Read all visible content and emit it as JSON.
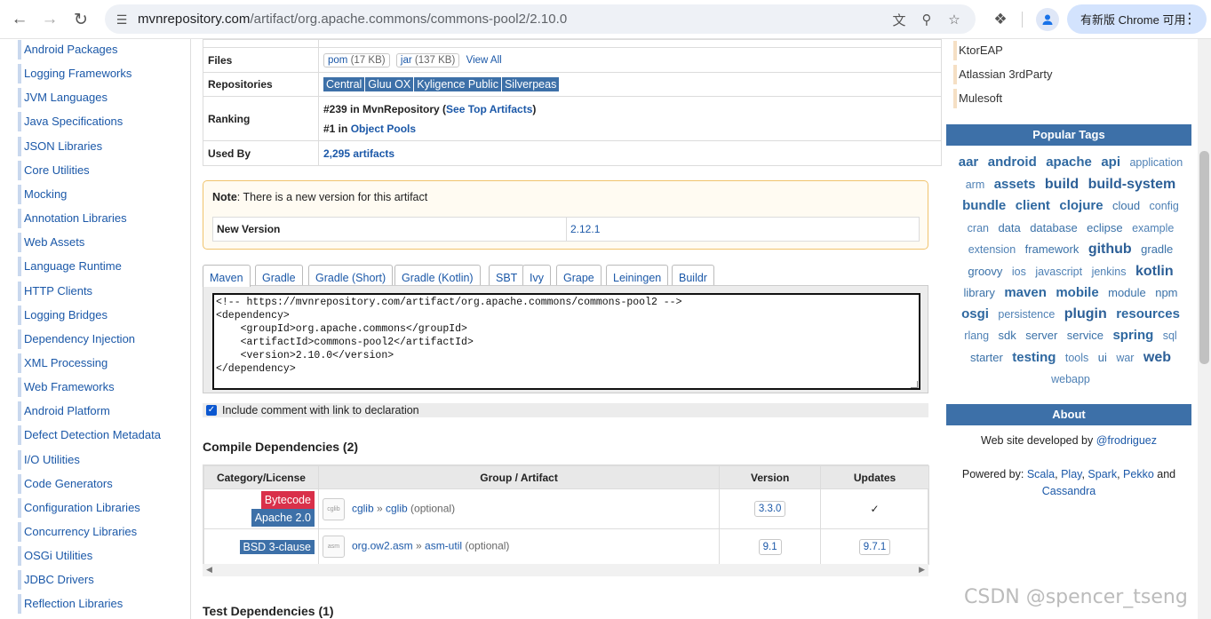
{
  "browser": {
    "url_host": "mvnrepository.com",
    "url_path": "/artifact/org.apache.commons/commons-pool2/2.10.0",
    "update_label": "有新版 Chrome 可用"
  },
  "left_nav": [
    "Android Packages",
    "Logging Frameworks",
    "JVM Languages",
    "Java Specifications",
    "JSON Libraries",
    "Core Utilities",
    "Mocking",
    "Annotation Libraries",
    "Web Assets",
    "Language Runtime",
    "HTTP Clients",
    "Logging Bridges",
    "Dependency Injection",
    "XML Processing",
    "Web Frameworks",
    "Android Platform",
    "Defect Detection Metadata",
    "I/O Utilities",
    "Code Generators",
    "Configuration Libraries",
    "Concurrency Libraries",
    "OSGi Utilities",
    "JDBC Drivers",
    "Reflection Libraries"
  ],
  "info": {
    "files_label": "Files",
    "file_pom": "pom",
    "file_pom_size": "(17 KB)",
    "file_jar": "jar",
    "file_jar_size": "(137 KB)",
    "view_all": "View All",
    "repos_label": "Repositories",
    "repos": [
      "Central",
      "Gluu OX",
      "Kyligence Public",
      "Silverpeas"
    ],
    "ranking_label": "Ranking",
    "rank1_prefix": "#239 in MvnRepository (",
    "rank1_link": "See Top Artifacts",
    "rank1_suffix": ")",
    "rank2_prefix": "#1 in ",
    "rank2_link": "Object Pools",
    "usedby_label": "Used By",
    "usedby_value": "2,295 artifacts"
  },
  "note": {
    "bold": "Note",
    "text": ": There is a new version for this artifact",
    "new_version_label": "New Version",
    "new_version_value": "2.12.1"
  },
  "tabs": [
    "Maven",
    "Gradle",
    "Gradle (Short)",
    "Gradle (Kotlin)",
    "SBT",
    "Ivy",
    "Grape",
    "Leiningen",
    "Buildr"
  ],
  "code": "<!-- https://mvnrepository.com/artifact/org.apache.commons/commons-pool2 -->\n<dependency>\n    <groupId>org.apache.commons</groupId>\n    <artifactId>commons-pool2</artifactId>\n    <version>2.10.0</version>\n</dependency>",
  "include_comment": "Include comment with link to declaration",
  "compile_title": "Compile Dependencies (2)",
  "deps_headers": {
    "license": "Category/License",
    "artifact": "Group / Artifact",
    "version": "Version",
    "updates": "Updates"
  },
  "deps": [
    {
      "lic1": "Bytecode",
      "lic2": "Apache 2.0",
      "group": "cglib",
      "artifact": "cglib",
      "optional": "(optional)",
      "version": "3.3.0",
      "update": "✓"
    },
    {
      "lic1": "BSD 3-clause",
      "group": "org.ow2.asm",
      "artifact": "asm-util",
      "optional": "(optional)",
      "version": "9.1",
      "update": "9.7.1"
    }
  ],
  "test_title": "Test Dependencies (1)",
  "right_repos": [
    "KtorEAP",
    "Atlassian 3rdParty",
    "Mulesoft"
  ],
  "popular_tags_title": "Popular Tags",
  "tags": [
    {
      "t": "aar",
      "s": 3
    },
    {
      "t": "android",
      "s": 3
    },
    {
      "t": "apache",
      "s": 3
    },
    {
      "t": "api",
      "s": 3
    },
    {
      "t": "application",
      "s": 1
    },
    {
      "t": "arm",
      "s": 1
    },
    {
      "t": "assets",
      "s": 3
    },
    {
      "t": "build",
      "s": 4
    },
    {
      "t": "build-system",
      "s": 4
    },
    {
      "t": "bundle",
      "s": 3
    },
    {
      "t": "client",
      "s": 3
    },
    {
      "t": "clojure",
      "s": 3
    },
    {
      "t": "cloud",
      "s": 2
    },
    {
      "t": "config",
      "s": 1
    },
    {
      "t": "cran",
      "s": 1
    },
    {
      "t": "data",
      "s": 2
    },
    {
      "t": "database",
      "s": 2
    },
    {
      "t": "eclipse",
      "s": 2
    },
    {
      "t": "example",
      "s": 1
    },
    {
      "t": "extension",
      "s": 1
    },
    {
      "t": "framework",
      "s": 2
    },
    {
      "t": "github",
      "s": 4
    },
    {
      "t": "gradle",
      "s": 2
    },
    {
      "t": "groovy",
      "s": 2
    },
    {
      "t": "ios",
      "s": 1
    },
    {
      "t": "javascript",
      "s": 1
    },
    {
      "t": "jenkins",
      "s": 1
    },
    {
      "t": "kotlin",
      "s": 4
    },
    {
      "t": "library",
      "s": 2
    },
    {
      "t": "maven",
      "s": 3
    },
    {
      "t": "mobile",
      "s": 3
    },
    {
      "t": "module",
      "s": 2
    },
    {
      "t": "npm",
      "s": 2
    },
    {
      "t": "osgi",
      "s": 3
    },
    {
      "t": "persistence",
      "s": 1
    },
    {
      "t": "plugin",
      "s": 4
    },
    {
      "t": "resources",
      "s": 3
    },
    {
      "t": "rlang",
      "s": 1
    },
    {
      "t": "sdk",
      "s": 2
    },
    {
      "t": "server",
      "s": 2
    },
    {
      "t": "service",
      "s": 2
    },
    {
      "t": "spring",
      "s": 3
    },
    {
      "t": "sql",
      "s": 1
    },
    {
      "t": "starter",
      "s": 2
    },
    {
      "t": "testing",
      "s": 3
    },
    {
      "t": "tools",
      "s": 1
    },
    {
      "t": "ui",
      "s": 2
    },
    {
      "t": "war",
      "s": 1
    },
    {
      "t": "web",
      "s": 4
    },
    {
      "t": "webapp",
      "s": 1
    }
  ],
  "about_title": "About",
  "about_line1": "Web site developed by ",
  "about_author": "@frodriguez",
  "about_line2": "Powered by: ",
  "powered": [
    "Scala",
    "Play",
    "Spark",
    "Pekko"
  ],
  "powered_and": " and ",
  "powered_last": "Cassandra",
  "watermark": "CSDN @spencer_tseng"
}
